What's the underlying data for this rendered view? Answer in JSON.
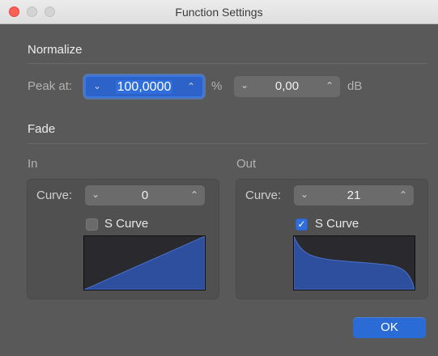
{
  "window": {
    "title": "Function Settings"
  },
  "normalize": {
    "heading": "Normalize",
    "peak_label": "Peak at:",
    "percent_value": "100,0000",
    "percent_unit": "%",
    "db_value": "0,00",
    "db_unit": "dB"
  },
  "fade": {
    "heading": "Fade",
    "in": {
      "label": "In",
      "curve_label": "Curve:",
      "curve_value": "0",
      "s_curve_label": "S Curve",
      "s_curve_checked": false
    },
    "out": {
      "label": "Out",
      "curve_label": "Curve:",
      "curve_value": "21",
      "s_curve_label": "S Curve",
      "s_curve_checked": true
    }
  },
  "buttons": {
    "ok_label": "OK"
  },
  "icons": {
    "stepper_down": "chevron-down-icon",
    "stepper_up": "chevron-up-icon",
    "checkmark": "checkmark-icon"
  },
  "colors": {
    "accent": "#2f6edb",
    "curve_fill": "#2d4f9e",
    "window_bg": "#595959"
  }
}
